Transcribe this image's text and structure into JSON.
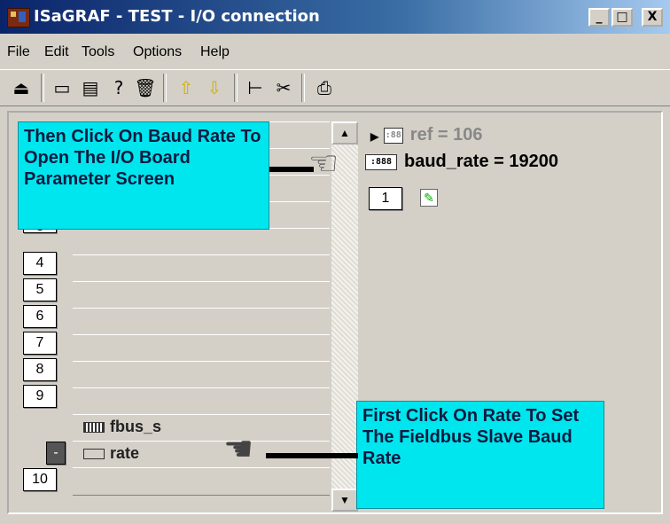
{
  "window": {
    "title": "ISaGRAF - TEST - I/O connection",
    "controls": [
      "_",
      "□",
      "X"
    ]
  },
  "menu": [
    "File",
    "Edit",
    "Tools",
    "Options",
    "Help"
  ],
  "toolbar": {
    "icons": [
      "open-icon",
      "board-icon",
      "copy-board-icon",
      "help-icon",
      "delete-icon",
      "up-arrow-icon",
      "down-arrow-icon",
      "tree-icon",
      "cut-icon",
      "print-icon"
    ]
  },
  "slots": {
    "numbers": [
      "3",
      "4",
      "5",
      "6",
      "7",
      "8",
      "9",
      "-",
      "10"
    ],
    "fbus_label": "fbus_s",
    "rate_label": "rate"
  },
  "params": {
    "ref": "ref = 106",
    "baud_rate": "baud_rate = 19200",
    "channel": "1"
  },
  "callouts": {
    "top": "Then Click On Baud Rate To Open The I/O Board Parameter Screen",
    "bottom": "First Click On Rate To Set The Fieldbus Slave Baud Rate"
  },
  "colors": {
    "callout_bg": "#00e6ee",
    "titlebar": "#0a246a"
  }
}
